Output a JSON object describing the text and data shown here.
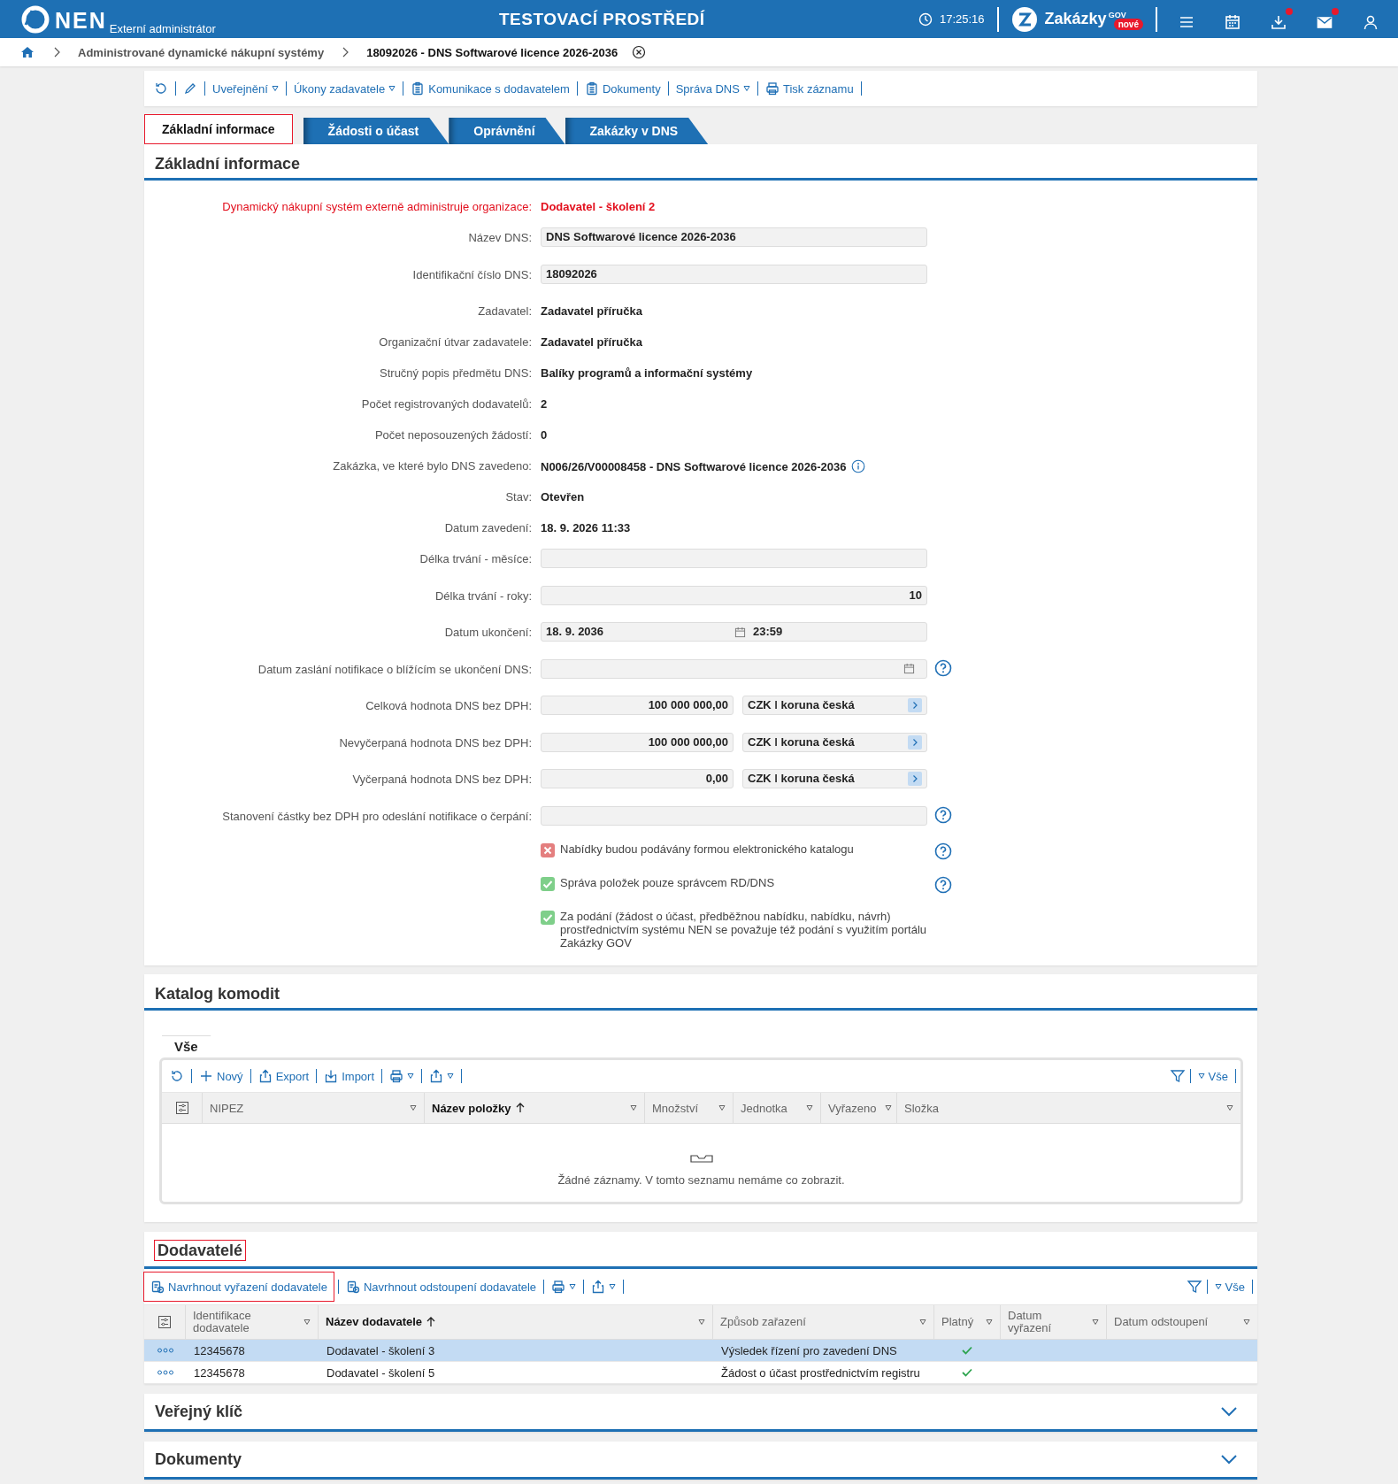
{
  "header": {
    "logo": "NEN",
    "subtitle": "Externí administrátor",
    "environment": "TESTOVACÍ PROSTŘEDÍ",
    "time": "17:25:16",
    "brand": "Zakázky",
    "brand_sup": "GOV",
    "badge": "nové",
    "icons": [
      {
        "kind": "menu",
        "dot": false
      },
      {
        "kind": "calendar",
        "dot": false
      },
      {
        "kind": "download",
        "dot": true
      },
      {
        "kind": "mail",
        "dot": true
      },
      {
        "kind": "user",
        "dot": false
      }
    ]
  },
  "breadcrumb": [
    "Administrované dynamické nákupní systémy",
    "18092026 - DNS Softwarové licence 2026-2036"
  ],
  "toolbar": [
    {
      "kind": "refresh"
    },
    {
      "kind": "edit"
    },
    {
      "kind": "plain",
      "label": "Uveřejnění",
      "dropdown": true
    },
    {
      "kind": "plain",
      "label": "Úkony zadavatele",
      "dropdown": true
    },
    {
      "kind": "clipboard",
      "label": "Komunikace s dodavatelem",
      "dropdown": false
    },
    {
      "kind": "clipboard",
      "label": "Dokumenty",
      "dropdown": false
    },
    {
      "kind": "plain",
      "label": "Správa DNS",
      "dropdown": true
    },
    {
      "kind": "print",
      "label": "Tisk záznamu",
      "dropdown": false
    }
  ],
  "tabs": [
    {
      "label": "Základní informace",
      "selected": true,
      "highlighted": true
    },
    {
      "label": "Žádosti o účast",
      "selected": false,
      "highlighted": false
    },
    {
      "label": "Oprávnění",
      "selected": false,
      "highlighted": false
    },
    {
      "label": "Zakázky v DNS",
      "selected": false,
      "highlighted": false
    }
  ],
  "basic_info": {
    "title": "Základní informace",
    "fields": [
      {
        "kind": "alert",
        "label": "Dynamický nákupní systém externě administruje organizace:",
        "value": "Dodavatel - školení 2",
        "help": false,
        "info": false
      },
      {
        "kind": "input",
        "label": "Název DNS:",
        "value": "DNS Softwarové licence 2026-2036",
        "help": false,
        "info": false
      },
      {
        "kind": "input",
        "label": "Identifikační číslo DNS:",
        "value": "18092026",
        "help": false,
        "info": false
      },
      {
        "kind": "text",
        "label": "Zadavatel:",
        "value": "Zadavatel příručka",
        "help": false,
        "info": false
      },
      {
        "kind": "text",
        "label": "Organizační útvar zadavatele:",
        "value": "Zadavatel příručka",
        "help": false,
        "info": false
      },
      {
        "kind": "text",
        "label": "Stručný popis předmětu DNS:",
        "value": "Balíky programů a informační systémy",
        "help": false,
        "info": false
      },
      {
        "kind": "text",
        "label": "Počet registrovaných dodavatelů:",
        "value": "2",
        "help": false,
        "info": false
      },
      {
        "kind": "text",
        "label": "Počet neposouzených žádostí:",
        "value": "0",
        "help": false,
        "info": false
      },
      {
        "kind": "text",
        "label": "Zakázka, ve které bylo DNS zavedeno:",
        "value": "N006/26/V00008458 - DNS Softwarové licence 2026-2036",
        "help": false,
        "info": true
      },
      {
        "kind": "text",
        "label": "Stav:",
        "value": "Otevřen",
        "help": false,
        "info": false
      },
      {
        "kind": "text",
        "label": "Datum zavedení:",
        "value": "18. 9. 2026 11:33",
        "help": false,
        "info": false
      },
      {
        "kind": "input",
        "label": "Délka trvání - měsíce:",
        "help": false,
        "info": false
      },
      {
        "kind": "number",
        "label": "Délka trvání - roky:",
        "value": "10",
        "help": false,
        "info": false
      },
      {
        "kind": "datetime",
        "label": "Datum ukončení:",
        "value": "18. 9. 2036",
        "time": "23:59",
        "help": false,
        "info": false
      },
      {
        "kind": "date",
        "label": "Datum zaslání notifikace o blížícím se ukončení DNS:",
        "help": true,
        "info": false
      },
      {
        "kind": "money",
        "label": "Celková hodnota DNS bez DPH:",
        "value": "100 000 000,00",
        "currency": "CZK ǀ koruna česká",
        "help": false,
        "info": false
      },
      {
        "kind": "money",
        "label": "Nevyčerpaná hodnota DNS bez DPH:",
        "value": "100 000 000,00",
        "currency": "CZK ǀ koruna česká",
        "help": false,
        "info": false
      },
      {
        "kind": "money",
        "label": "Vyčerpaná hodnota DNS bez DPH:",
        "value": "0,00",
        "currency": "CZK ǀ koruna česká",
        "help": false,
        "info": false
      },
      {
        "kind": "input",
        "label": "Stanovení částky bez DPH pro odeslání notifikace o čerpání:",
        "help": true,
        "info": false
      }
    ],
    "checkboxes": [
      {
        "label": "Nabídky budou podávány formou elektronického katalogu",
        "checked": false,
        "help": true
      },
      {
        "label": "Správa položek pouze správcem RD/DNS",
        "checked": true,
        "help": true
      },
      {
        "label": "Za podání (žádost o účast, předběžnou nabídku, nabídku, návrh) prostřednictvím systému NEN se považuje též podání s využitím portálu Zakázky GOV",
        "checked": true,
        "help": false
      }
    ]
  },
  "catalog": {
    "title": "Katalog komodit",
    "tab": "Vše",
    "toolbar": [
      {
        "kind": "refresh",
        "dropdown": false
      },
      {
        "kind": "plus",
        "label": "Nový",
        "dropdown": false
      },
      {
        "kind": "export",
        "label": "Export",
        "dropdown": false
      },
      {
        "kind": "import",
        "label": "Import",
        "dropdown": false
      },
      {
        "kind": "print",
        "dropdown": true
      },
      {
        "kind": "share",
        "dropdown": true
      }
    ],
    "filter_label": "Vše",
    "columns": [
      {
        "label": "NIPEZ",
        "sorted": false
      },
      {
        "label": "Název položky",
        "sorted": true
      },
      {
        "label": "Množství",
        "sorted": false
      },
      {
        "label": "Jednotka",
        "sorted": false
      },
      {
        "label": "Vyřazeno",
        "sorted": false
      },
      {
        "label": "Složka",
        "sorted": false
      }
    ],
    "empty_message": "Žádné záznamy. V tomto seznamu nemáme co zobrazit."
  },
  "suppliers": {
    "title": "Dodavatelé",
    "highlighted": true,
    "toolbar": [
      {
        "kind": "proposal",
        "label": "Navrhnout vyřazení dodavatele",
        "dropdown": false,
        "highlighted": true
      },
      {
        "kind": "proposal",
        "label": "Navrhnout odstoupení dodavatele",
        "dropdown": false,
        "highlighted": false
      },
      {
        "kind": "print",
        "dropdown": true,
        "highlighted": false
      },
      {
        "kind": "share",
        "dropdown": true,
        "highlighted": false
      }
    ],
    "filter_label": "Vše",
    "columns": [
      {
        "label": "Identifikace dodavatele",
        "sorted": false
      },
      {
        "label": "Název dodavatele",
        "sorted": true
      },
      {
        "label": "Způsob zařazení",
        "sorted": false
      },
      {
        "label": "Platný",
        "sorted": false
      },
      {
        "label": "Datum vyřazení",
        "sorted": false
      },
      {
        "label": "Datum odstoupení",
        "sorted": false
      }
    ],
    "rows": [
      {
        "selected": true,
        "id": "12345678",
        "name": "Dodavatel - školení 3",
        "method": "Výsledek řízení pro zavedení DNS",
        "valid": true
      },
      {
        "selected": false,
        "id": "12345678",
        "name": "Dodavatel - školení 5",
        "method": "Žádost o účast prostřednictvím registru",
        "valid": true
      }
    ]
  },
  "collapsed_sections": [
    {
      "title": "Veřejný klíč",
      "expanded": false
    },
    {
      "title": "Dokumenty",
      "expanded": false
    }
  ]
}
